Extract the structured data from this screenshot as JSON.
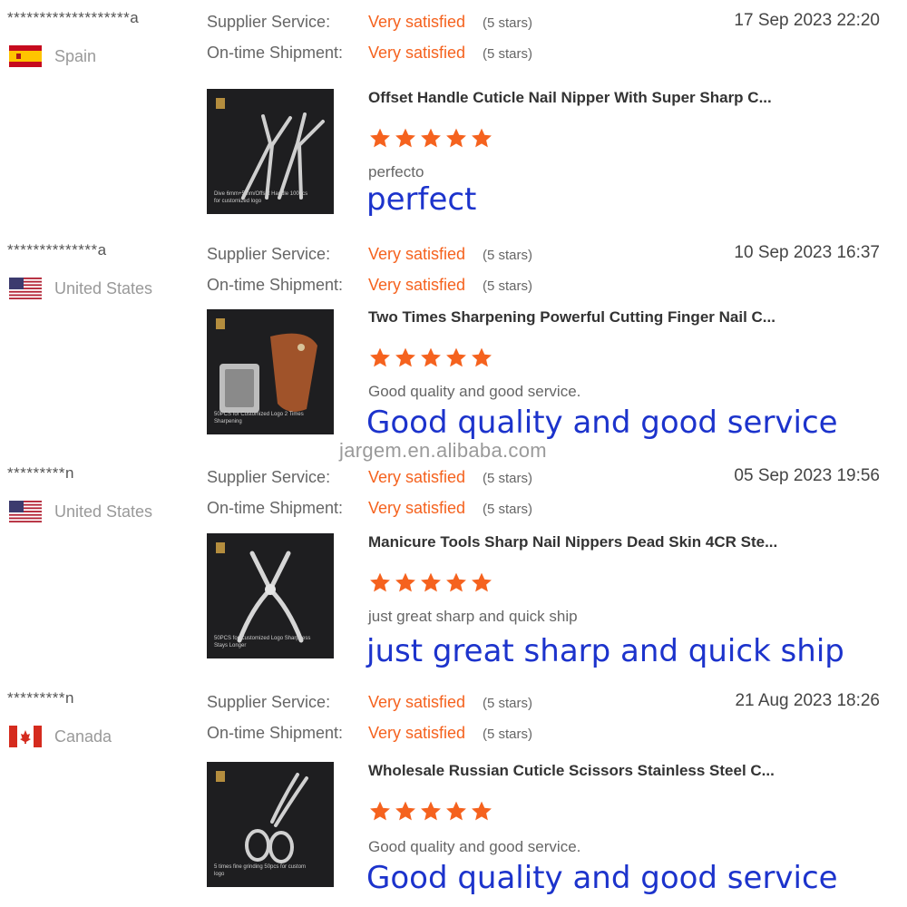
{
  "labels": {
    "supplier_service": "Supplier Service:",
    "ontime_shipment": "On-time Shipment:",
    "very_satisfied": "Very satisfied",
    "five_stars": "(5 stars)"
  },
  "watermark": "jargem.en.alibaba.com",
  "colors": {
    "accent": "#f5621e",
    "translation": "#1c33cc",
    "star": "#f5621e"
  },
  "reviews": [
    {
      "buyer": "*******************a",
      "country": "Spain",
      "flag": "spain-flag-icon",
      "date": "17 Sep 2023 22:20",
      "product_title": "Offset Handle Cuticle Nail Nipper With Super Sharp C...",
      "rating": 5,
      "comment": "perfecto",
      "translation": "perfect",
      "thumb_caption": "Dive 6mm+5mm/Offset Handle 100pcs for customized logo"
    },
    {
      "buyer": "**************a",
      "country": "United States",
      "flag": "us-flag-icon",
      "date": "10 Sep 2023 16:37",
      "product_title": "Two Times Sharpening Powerful Cutting Finger Nail C...",
      "rating": 5,
      "comment": "Good quality and good service.",
      "translation": "Good quality and good service",
      "thumb_caption": "50PCS for Customized Logo 2 Times Sharpening"
    },
    {
      "buyer": "*********n",
      "country": "United States",
      "flag": "us-flag-icon",
      "date": "05 Sep 2023 19:56",
      "product_title": "Manicure Tools Sharp Nail Nippers Dead Skin 4CR Ste...",
      "rating": 5,
      "comment": "just great sharp and quick ship",
      "translation": "just great sharp and quick ship",
      "thumb_caption": "50PCS for Customized Logo Sharpness Stays Longer"
    },
    {
      "buyer": "*********n",
      "country": "Canada",
      "flag": "canada-flag-icon",
      "date": "21 Aug 2023 18:26",
      "product_title": "Wholesale Russian Cuticle Scissors Stainless Steel C...",
      "rating": 5,
      "comment": "Good quality and good service.",
      "translation": "Good quality and good service",
      "thumb_caption": "5 times fine grinding 50pcs for custom logo"
    }
  ]
}
